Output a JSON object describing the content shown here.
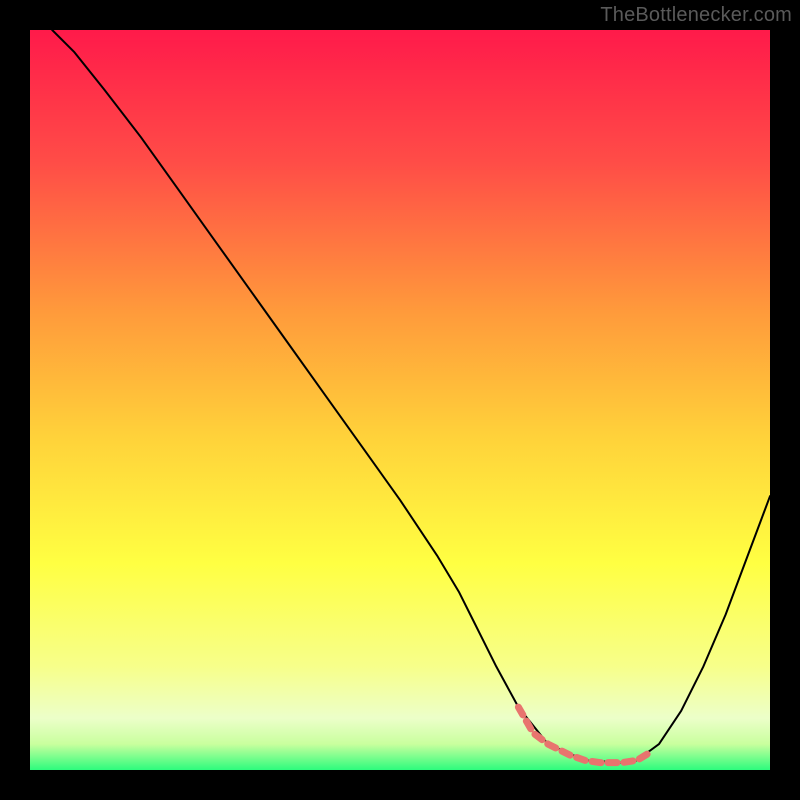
{
  "watermark": "TheBottlenecker.com",
  "chart_data": {
    "type": "line",
    "title": "",
    "xlabel": "",
    "ylabel": "",
    "xlim": [
      0,
      100
    ],
    "ylim": [
      0,
      100
    ],
    "grid": false,
    "background_gradient": {
      "direction": "vertical",
      "stops": [
        {
          "pos": 0.0,
          "color": "#ff1a4a"
        },
        {
          "pos": 0.18,
          "color": "#ff4d47"
        },
        {
          "pos": 0.38,
          "color": "#ff9a3b"
        },
        {
          "pos": 0.55,
          "color": "#ffd23a"
        },
        {
          "pos": 0.72,
          "color": "#ffff42"
        },
        {
          "pos": 0.86,
          "color": "#f7ff8a"
        },
        {
          "pos": 0.93,
          "color": "#ecffc9"
        },
        {
          "pos": 0.965,
          "color": "#c9ff9e"
        },
        {
          "pos": 1.0,
          "color": "#2dfc7d"
        }
      ]
    },
    "series": [
      {
        "name": "bottleneck-curve",
        "stroke": "#000000",
        "stroke_width": 2,
        "x": [
          3,
          6,
          10,
          15,
          20,
          25,
          30,
          35,
          40,
          45,
          50,
          55,
          58,
          60,
          63,
          66,
          70,
          75,
          80,
          82,
          85,
          88,
          91,
          94,
          97,
          100
        ],
        "y": [
          100,
          97,
          92,
          85.5,
          78.5,
          71.5,
          64.5,
          57.5,
          50.5,
          43.5,
          36.5,
          29,
          24,
          20,
          14,
          8.5,
          3.5,
          1.3,
          1.0,
          1.3,
          3.5,
          8,
          14,
          21,
          29,
          37
        ]
      },
      {
        "name": "highlight-valley",
        "stroke": "#e8746e",
        "stroke_width": 7,
        "dasharray": "9 7",
        "x": [
          66,
          68,
          70,
          73,
          75,
          77,
          80,
          82,
          84
        ],
        "y": [
          8.5,
          5,
          3.5,
          2,
          1.3,
          1.0,
          1.0,
          1.3,
          2.5
        ]
      }
    ]
  }
}
